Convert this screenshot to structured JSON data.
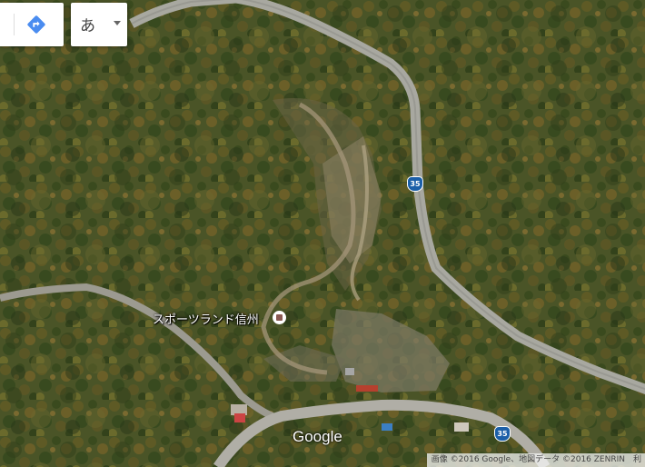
{
  "toolbar": {
    "directions_icon": "directions-icon",
    "ime_label": "あ",
    "ime_menu_icon": "caret-down-icon"
  },
  "map": {
    "type": "satellite",
    "place": {
      "name": "スポーツランド信州",
      "icon": "place-marker-icon"
    },
    "route_shields": [
      "35",
      "35"
    ]
  },
  "footer": {
    "logo": "Google",
    "attribution": "画像 ©2016 Google、地図データ ©2016 ZENRIN　利"
  }
}
